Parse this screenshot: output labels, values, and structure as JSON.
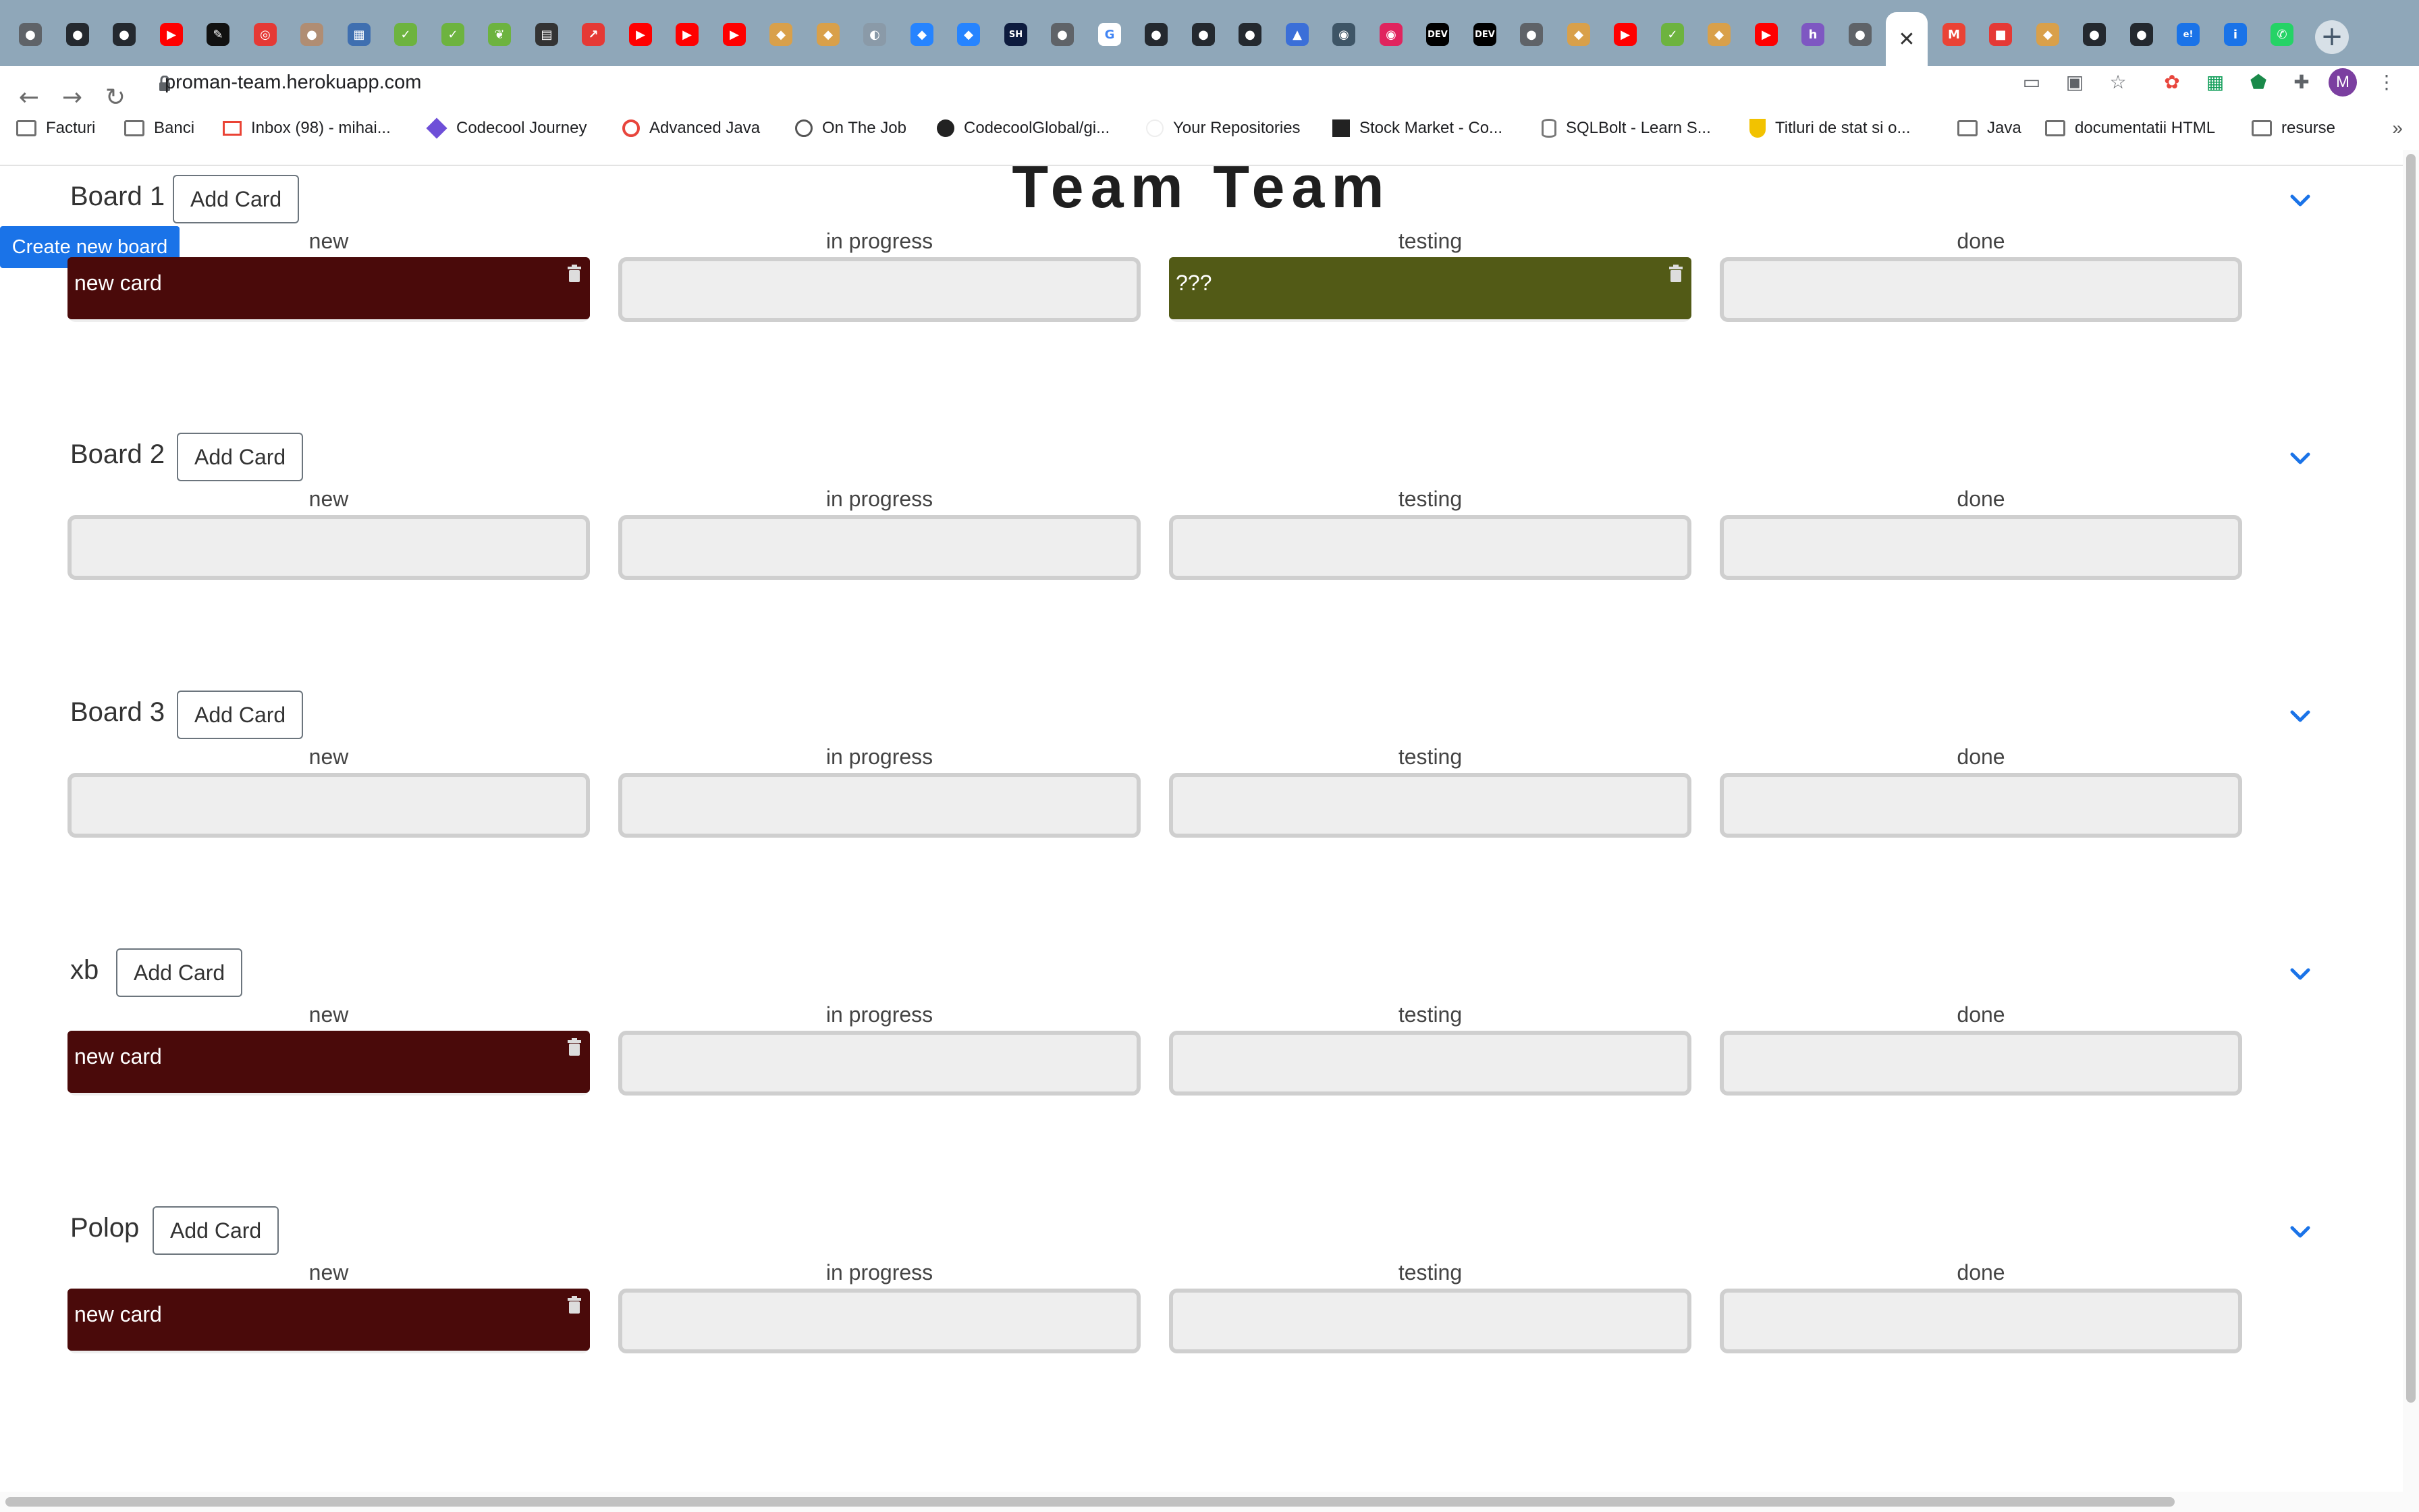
{
  "browser": {
    "url": "proman-team.herokuapp.com",
    "profile_initial": "M",
    "tab_icons": [
      {
        "color": "#5f6368",
        "glyph": "●"
      },
      {
        "color": "#24292f",
        "glyph": "●"
      },
      {
        "color": "#24292f",
        "glyph": "●"
      },
      {
        "color": "#ff0000",
        "glyph": "▶"
      },
      {
        "color": "#111111",
        "glyph": "✎"
      },
      {
        "color": "#e53935",
        "glyph": "◎"
      },
      {
        "color": "#b08d73",
        "glyph": "●"
      },
      {
        "color": "#3f6fb0",
        "glyph": "▦"
      },
      {
        "color": "#6db33f",
        "glyph": "✓"
      },
      {
        "color": "#6db33f",
        "glyph": "✓"
      },
      {
        "color": "#6db33f",
        "glyph": "❦"
      },
      {
        "color": "#333333",
        "glyph": "▤"
      },
      {
        "color": "#e53935",
        "glyph": "↗"
      },
      {
        "color": "#ff0000",
        "glyph": "▶"
      },
      {
        "color": "#ff0000",
        "glyph": "▶"
      },
      {
        "color": "#ff0000",
        "glyph": "▶"
      },
      {
        "color": "#d9a04a",
        "glyph": "◆"
      },
      {
        "color": "#d9a04a",
        "glyph": "◆"
      },
      {
        "color": "#8a9aa8",
        "glyph": "◐"
      },
      {
        "color": "#2684ff",
        "glyph": "◆"
      },
      {
        "color": "#2684ff",
        "glyph": "◆"
      },
      {
        "color": "#0d1b3e",
        "glyph": "SH"
      },
      {
        "color": "#5f6368",
        "glyph": "●"
      },
      {
        "color": "#ffffff",
        "glyph": "G"
      },
      {
        "color": "#24292f",
        "glyph": "●"
      },
      {
        "color": "#24292f",
        "glyph": "●"
      },
      {
        "color": "#24292f",
        "glyph": "●"
      },
      {
        "color": "#3b6fd8",
        "glyph": "▲"
      },
      {
        "color": "#3e5566",
        "glyph": "◉"
      },
      {
        "color": "#e0245e",
        "glyph": "◉"
      },
      {
        "color": "#000000",
        "glyph": "DEV"
      },
      {
        "color": "#000000",
        "glyph": "DEV"
      },
      {
        "color": "#5f6368",
        "glyph": "●"
      },
      {
        "color": "#d9a04a",
        "glyph": "◆"
      },
      {
        "color": "#ff0000",
        "glyph": "▶"
      },
      {
        "color": "#6db33f",
        "glyph": "✓"
      },
      {
        "color": "#d9a04a",
        "glyph": "◆"
      },
      {
        "color": "#ff0000",
        "glyph": "▶"
      },
      {
        "color": "#7e57c2",
        "glyph": "h"
      },
      {
        "color": "#5f6368",
        "glyph": "●"
      },
      {
        "color": "#ffffff",
        "glyph": "✕"
      },
      {
        "color": "#ea4335",
        "glyph": "M"
      },
      {
        "color": "#e53935",
        "glyph": "■"
      },
      {
        "color": "#d9a04a",
        "glyph": "◆"
      },
      {
        "color": "#24292f",
        "glyph": "●"
      },
      {
        "color": "#24292f",
        "glyph": "●"
      },
      {
        "color": "#1a73e8",
        "glyph": "e!"
      },
      {
        "color": "#1a73e8",
        "glyph": "i"
      },
      {
        "color": "#25d366",
        "glyph": "✆"
      }
    ],
    "bookmarks": [
      {
        "label": "Facturi",
        "icon": "folder"
      },
      {
        "label": "Banci",
        "icon": "folder"
      },
      {
        "label": "Inbox (98) - mihai...",
        "icon": "gmail"
      },
      {
        "label": "Codecool Journey",
        "icon": "codecool"
      },
      {
        "label": "Advanced Java",
        "icon": "codecool-ring"
      },
      {
        "label": "On The Job",
        "icon": "globe"
      },
      {
        "label": "CodecoolGlobal/gi...",
        "icon": "github"
      },
      {
        "label": "Your Repositories",
        "icon": "blank"
      },
      {
        "label": "Stock Market - Co...",
        "icon": "stock"
      },
      {
        "label": "SQLBolt - Learn S...",
        "icon": "db"
      },
      {
        "label": "Titluri de stat si o...",
        "icon": "bt"
      },
      {
        "label": "Java",
        "icon": "folder"
      },
      {
        "label": "documentatii HTML",
        "icon": "folder"
      },
      {
        "label": "resurse",
        "icon": "folder"
      }
    ],
    "bookmarks_more": "»"
  },
  "page": {
    "title": "Team Team",
    "create_board_label": "Create new board",
    "add_card_label": "Add Card",
    "colors": {
      "accent": "#1a73e8",
      "card_dark_red": "#4a0a0a",
      "card_olive": "#525a16"
    },
    "boards": [
      {
        "title": "Board 1",
        "columns": [
          {
            "title": "new",
            "cards": [
              {
                "text": "new card",
                "color": "#4a0a0a"
              }
            ]
          },
          {
            "title": "in progress",
            "cards": []
          },
          {
            "title": "testing",
            "cards": [
              {
                "text": "???",
                "color": "#525a16"
              }
            ]
          },
          {
            "title": "done",
            "cards": []
          }
        ]
      },
      {
        "title": "Board 2",
        "columns": [
          {
            "title": "new",
            "cards": []
          },
          {
            "title": "in progress",
            "cards": []
          },
          {
            "title": "testing",
            "cards": []
          },
          {
            "title": "done",
            "cards": []
          }
        ]
      },
      {
        "title": "Board 3",
        "columns": [
          {
            "title": "new",
            "cards": []
          },
          {
            "title": "in progress",
            "cards": []
          },
          {
            "title": "testing",
            "cards": []
          },
          {
            "title": "done",
            "cards": []
          }
        ]
      },
      {
        "title": "xb",
        "columns": [
          {
            "title": "new",
            "cards": [
              {
                "text": "new card",
                "color": "#4a0a0a"
              }
            ]
          },
          {
            "title": "in progress",
            "cards": []
          },
          {
            "title": "testing",
            "cards": []
          },
          {
            "title": "done",
            "cards": []
          }
        ]
      },
      {
        "title": "Polop",
        "columns": [
          {
            "title": "new",
            "cards": [
              {
                "text": "new card",
                "color": "#4a0a0a"
              }
            ]
          },
          {
            "title": "in progress",
            "cards": []
          },
          {
            "title": "testing",
            "cards": []
          },
          {
            "title": "done",
            "cards": []
          }
        ]
      }
    ]
  }
}
